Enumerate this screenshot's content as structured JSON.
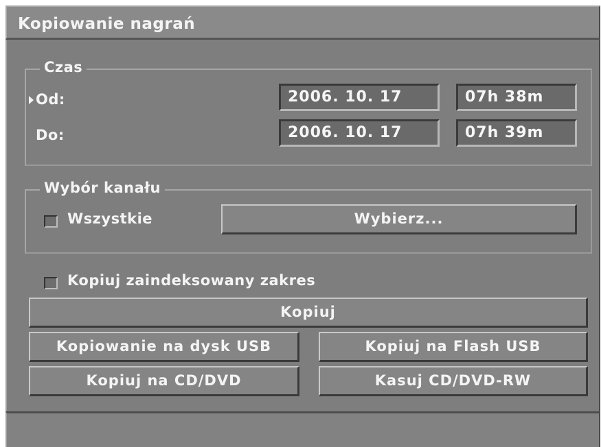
{
  "window": {
    "title": "Kopiowanie nagrań"
  },
  "time_group": {
    "legend": "Czas",
    "from": {
      "label": "Od:",
      "date": "2006. 10. 17",
      "time": "07h 38m",
      "selected": true
    },
    "to": {
      "label": "Do:",
      "date": "2006. 10. 17",
      "time": "07h 39m"
    }
  },
  "channel_group": {
    "legend": "Wybór kanału",
    "all_checkbox": {
      "label": "Wszystkie",
      "checked": false
    },
    "select_button": "Wybierz..."
  },
  "indexed_range": {
    "label": "Kopiuj zaindeksowany zakres",
    "checked": false
  },
  "buttons": {
    "copy": "Kopiuj",
    "copy_usb_disk": "Kopiowanie na dysk USB",
    "copy_usb_flash": "Kopiuj na Flash USB",
    "copy_cd_dvd": "Kopiuj na CD/DVD",
    "erase_cd_dvd_rw": "Kasuj CD/DVD-RW"
  },
  "status_bar": {
    "text": ""
  },
  "colors": {
    "window_bg": "#7e7e7e",
    "field_bg": "#6a6a6a",
    "text": "#f4f4f4"
  }
}
